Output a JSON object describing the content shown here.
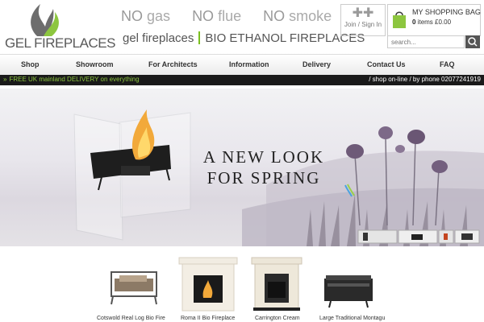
{
  "brand": {
    "name": "GEL FIREPLACES"
  },
  "taglines": {
    "no1": "NO",
    "w1": "gas",
    "no2": "NO",
    "w2": "flue",
    "no3": "NO",
    "w3": "smoke",
    "sub_left": "gel fireplaces",
    "sub_right": "BIO ETHANOL FIREPLACES"
  },
  "account": {
    "join_label": "Join / Sign In"
  },
  "bag": {
    "title": "MY SHOPPING BAG",
    "count": "0",
    "items_text": "items £0.00"
  },
  "search": {
    "placeholder": "search..."
  },
  "nav": {
    "items": [
      {
        "label": "Shop"
      },
      {
        "label": "Showroom"
      },
      {
        "label": "For Architects"
      },
      {
        "label": "Information"
      },
      {
        "label": "Delivery"
      },
      {
        "label": "Contact Us"
      },
      {
        "label": "FAQ"
      }
    ]
  },
  "delivery": {
    "left": "FREE UK mainland DELIVERY on everything",
    "right": "/ shop on-line / by phone 02077241919"
  },
  "banner": {
    "line1": "A NEW LOOK",
    "line2": "FOR SPRING"
  },
  "products": [
    {
      "name": "Cotswold Real Log Bio Fire"
    },
    {
      "name": "Roma II Bio Fireplace"
    },
    {
      "name": "Carrington Cream"
    },
    {
      "name": "Large Traditional Montagu"
    }
  ],
  "colors": {
    "accent": "#8dc63f",
    "dark_bar": "#1a1a1a"
  }
}
